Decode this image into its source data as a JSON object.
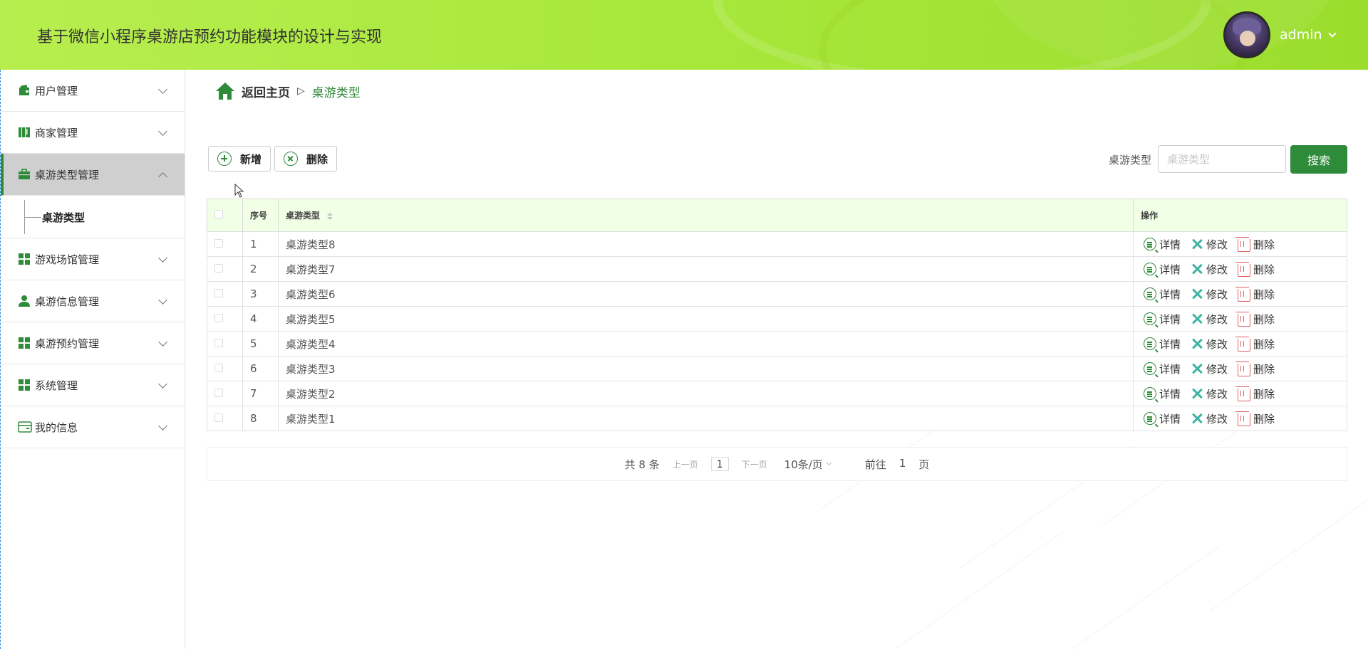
{
  "header": {
    "title": "基于微信小程序桌游店预约功能模块的设计与实现",
    "username": "admin"
  },
  "sidebar": {
    "items": [
      {
        "label": "用户管理",
        "icon": "wallet-icon"
      },
      {
        "label": "商家管理",
        "icon": "book-icon"
      },
      {
        "label": "桌游类型管理",
        "icon": "briefcase-icon",
        "active": true
      },
      {
        "label": "游戏场馆管理",
        "icon": "grid-icon"
      },
      {
        "label": "桌游信息管理",
        "icon": "user-icon"
      },
      {
        "label": "桌游预约管理",
        "icon": "grid-icon"
      },
      {
        "label": "系统管理",
        "icon": "grid-icon"
      },
      {
        "label": "我的信息",
        "icon": "card-icon"
      }
    ],
    "submenu": {
      "label": "桌游类型"
    }
  },
  "breadcrumb": {
    "home": "返回主页",
    "separator": "▷",
    "current": "桌游类型"
  },
  "toolbar": {
    "add_label": "新增",
    "delete_label": "删除"
  },
  "search": {
    "label": "桌游类型",
    "placeholder": "桌游类型",
    "button": "搜索"
  },
  "table": {
    "headers": {
      "index": "序号",
      "type": "桌游类型",
      "ops": "操作"
    },
    "rows": [
      {
        "index": "1",
        "type": "桌游类型8"
      },
      {
        "index": "2",
        "type": "桌游类型7"
      },
      {
        "index": "3",
        "type": "桌游类型6"
      },
      {
        "index": "4",
        "type": "桌游类型5"
      },
      {
        "index": "5",
        "type": "桌游类型4"
      },
      {
        "index": "6",
        "type": "桌游类型3"
      },
      {
        "index": "7",
        "type": "桌游类型2"
      },
      {
        "index": "8",
        "type": "桌游类型1"
      }
    ],
    "op_labels": {
      "detail": "详情",
      "edit": "修改",
      "delete": "删除"
    }
  },
  "pagination": {
    "total": "共 8 条",
    "prev": "上一页",
    "page": "1",
    "next": "下一页",
    "page_size": "10条/页",
    "goto_label": "前往",
    "goto_page": "1",
    "goto_suffix": "页"
  },
  "colors": {
    "accent": "#2e8b3a",
    "header_bg": "#a9e83d",
    "table_header_bg": "#f0ffe6"
  }
}
